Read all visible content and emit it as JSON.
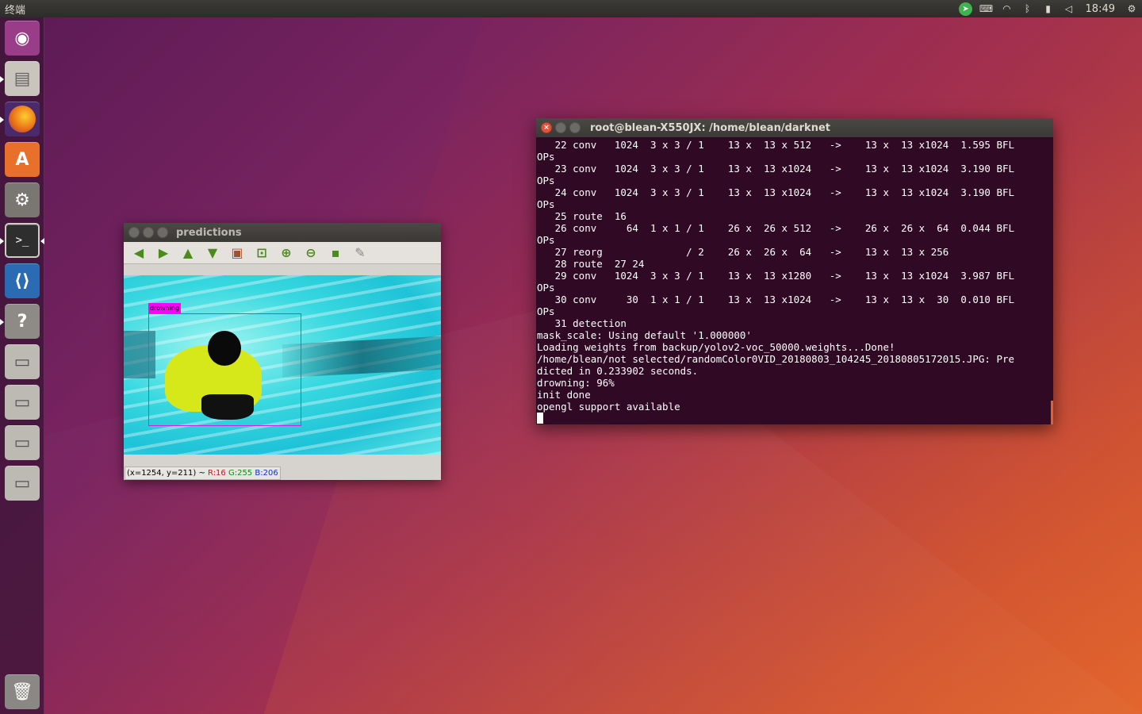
{
  "top_panel": {
    "app_title": "终端",
    "clock": "18:49",
    "indicators": [
      "telegram-icon",
      "keyboard-icon",
      "wifi-icon",
      "bluetooth-icon",
      "battery-icon",
      "volume-muted-icon",
      "settings-gear-icon"
    ]
  },
  "launcher": {
    "items": [
      {
        "name": "ubuntu-dash",
        "icon": "ubuntu-logo-icon",
        "color": "#8c3b7f"
      },
      {
        "name": "files",
        "icon": "file-cabinet-icon",
        "color": "#c9c4bc"
      },
      {
        "name": "firefox",
        "icon": "firefox-icon",
        "color": "#e66a14"
      },
      {
        "name": "software-center",
        "icon": "shopping-bag-icon",
        "color": "#e8702a"
      },
      {
        "name": "system-settings",
        "icon": "wrench-gear-icon",
        "color": "#7a7773"
      },
      {
        "name": "terminal",
        "icon": "terminal-icon",
        "color": "#3a3a3a"
      },
      {
        "name": "vscode",
        "icon": "vscode-icon",
        "color": "#2b6bb3"
      },
      {
        "name": "help",
        "icon": "question-icon",
        "color": "#8e8b87"
      },
      {
        "name": "drive-1",
        "icon": "disk-drive-icon",
        "color": "#bdb9b3"
      },
      {
        "name": "drive-2",
        "icon": "disk-drive-icon",
        "color": "#bdb9b3"
      },
      {
        "name": "drive-3",
        "icon": "disk-drive-icon",
        "color": "#bdb9b3"
      },
      {
        "name": "drive-4",
        "icon": "disk-drive-icon",
        "color": "#bdb9b3"
      },
      {
        "name": "trash",
        "icon": "trash-icon",
        "color": "#8a8784"
      }
    ]
  },
  "predictions_window": {
    "title": "predictions",
    "toolbar": [
      "arrow-left-icon",
      "arrow-right-icon",
      "arrow-up-icon",
      "arrow-down-icon",
      "image-icon",
      "zoom-fit-icon",
      "zoom-in-icon",
      "zoom-out-icon",
      "save-icon",
      "brush-icon"
    ],
    "detection_label": "drowning",
    "status": {
      "coords": "(x=1254, y=211) ~",
      "r": "R:16",
      "g": "G:255",
      "b": "B:206"
    }
  },
  "terminal_window": {
    "title": "root@blean-X550JX: /home/blean/darknet",
    "lines": [
      "   22 conv   1024  3 x 3 / 1    13 x  13 x 512   ->    13 x  13 x1024  1.595 BFL",
      "OPs",
      "   23 conv   1024  3 x 3 / 1    13 x  13 x1024   ->    13 x  13 x1024  3.190 BFL",
      "OPs",
      "   24 conv   1024  3 x 3 / 1    13 x  13 x1024   ->    13 x  13 x1024  3.190 BFL",
      "OPs",
      "   25 route  16",
      "   26 conv     64  1 x 1 / 1    26 x  26 x 512   ->    26 x  26 x  64  0.044 BFL",
      "OPs",
      "   27 reorg              / 2    26 x  26 x  64   ->    13 x  13 x 256",
      "   28 route  27 24",
      "   29 conv   1024  3 x 3 / 1    13 x  13 x1280   ->    13 x  13 x1024  3.987 BFL",
      "OPs",
      "   30 conv     30  1 x 1 / 1    13 x  13 x1024   ->    13 x  13 x  30  0.010 BFL",
      "OPs",
      "   31 detection",
      "mask_scale: Using default '1.000000'",
      "Loading weights from backup/yolov2-voc_50000.weights...Done!",
      "/home/blean/not selected/randomColor0VID_20180803_104245_20180805172015.JPG: Pre",
      "dicted in 0.233902 seconds.",
      "drowning: 96%",
      "init done",
      "opengl support available"
    ]
  }
}
